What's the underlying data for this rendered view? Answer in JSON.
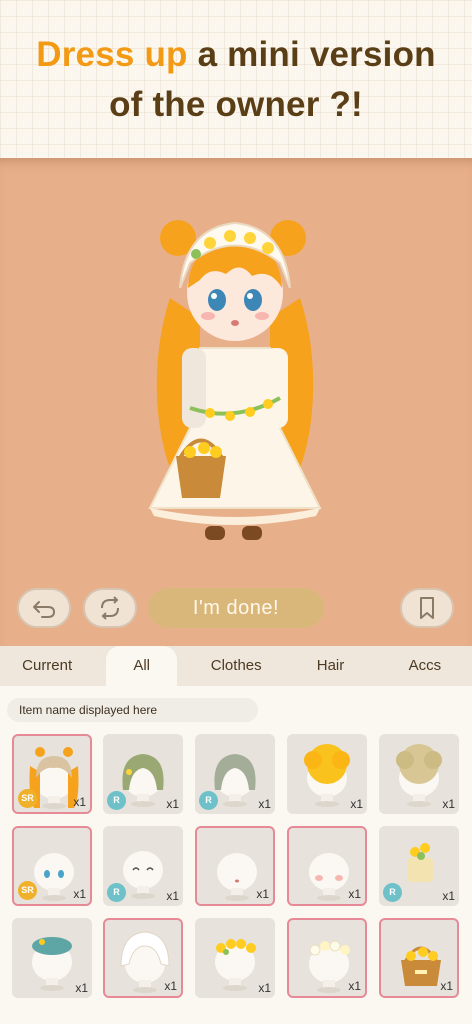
{
  "header": {
    "headline_accent": "Dress up",
    "headline_rest_1": "a mini version",
    "headline_line_2": "of the owner ?!"
  },
  "toolbar": {
    "done_label": "I'm done!",
    "undo_icon": "undo-arrow-icon",
    "randomize_icon": "shuffle-icon",
    "save_icon": "bookmark-icon"
  },
  "tabs": [
    {
      "label": "Current"
    },
    {
      "label": "All",
      "active": true
    },
    {
      "label": "Clothes"
    },
    {
      "label": "Hair"
    },
    {
      "label": "Accs"
    }
  ],
  "item_name_placeholder": "Item name displayed here",
  "items": [
    {
      "kind": "hair-twintails-orange",
      "rarity": "SR",
      "qty": "x1",
      "selected": true
    },
    {
      "kind": "hair-bob-green",
      "rarity": "R",
      "qty": "x1",
      "selected": false
    },
    {
      "kind": "hair-bob-sage",
      "rarity": "R",
      "qty": "x1",
      "selected": false
    },
    {
      "kind": "hair-afro-yellow",
      "rarity": "",
      "qty": "x1",
      "selected": false
    },
    {
      "kind": "hair-afro-beige",
      "rarity": "",
      "qty": "x1",
      "selected": false
    },
    {
      "kind": "face-blue-eyes",
      "rarity": "SR",
      "qty": "x1",
      "selected": true
    },
    {
      "kind": "face-smile",
      "rarity": "R",
      "qty": "x1",
      "selected": false
    },
    {
      "kind": "face-small-mouth",
      "rarity": "",
      "qty": "x1",
      "selected": true
    },
    {
      "kind": "face-blush",
      "rarity": "",
      "qty": "x1",
      "selected": true
    },
    {
      "kind": "acc-flower-mug",
      "rarity": "R",
      "qty": "x1",
      "selected": false
    },
    {
      "kind": "hat-teal-beret",
      "rarity": "",
      "qty": "x1",
      "selected": false
    },
    {
      "kind": "bonnet-white-lace",
      "rarity": "",
      "qty": "x1",
      "selected": true
    },
    {
      "kind": "crown-yellow-flowers",
      "rarity": "",
      "qty": "x1",
      "selected": false
    },
    {
      "kind": "crown-white-flowers",
      "rarity": "",
      "qty": "x1",
      "selected": true
    },
    {
      "kind": "basket-flowers",
      "rarity": "",
      "qty": "x1",
      "selected": true
    }
  ],
  "colors": {
    "stage": "#e8b08a",
    "accent_text": "#f39a15",
    "headline_text": "#5a3e16",
    "done_button": "#d9b77b",
    "selected_border": "#e78a98"
  }
}
